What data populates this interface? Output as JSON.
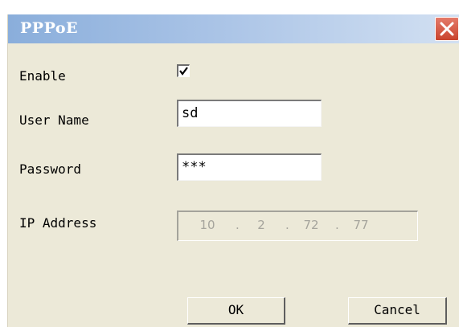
{
  "window": {
    "title": "PPPoE",
    "close_icon": "close-x-icon"
  },
  "colors": {
    "title_gradient_start": "#8aaedb",
    "title_gradient_end": "#d2e0f2",
    "close_button": "#c9432d",
    "dialog_bg": "#ece9d8"
  },
  "form": {
    "enable": {
      "label": "Enable",
      "checked": true
    },
    "username": {
      "label": "User Name",
      "value": "sd"
    },
    "password": {
      "label": "Password",
      "value": "***"
    },
    "ip_address": {
      "label": "IP Address",
      "octets": [
        "10",
        "2",
        "72",
        "77"
      ],
      "disabled": true
    }
  },
  "buttons": {
    "ok": "OK",
    "cancel": "Cancel"
  }
}
